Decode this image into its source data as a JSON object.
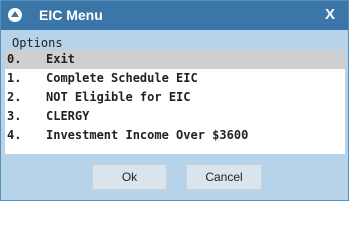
{
  "window": {
    "title": "EIC Menu",
    "close_label": "X",
    "icon": "app-icon"
  },
  "options": {
    "label": "Options",
    "selected_index": 0,
    "items": [
      {
        "num": "0.",
        "label": "Exit"
      },
      {
        "num": "1.",
        "label": "Complete Schedule EIC"
      },
      {
        "num": "2.",
        "label": "NOT Eligible for EIC"
      },
      {
        "num": "3.",
        "label": "CLERGY"
      },
      {
        "num": "4.",
        "label": "Investment Income Over $3600"
      }
    ]
  },
  "buttons": {
    "ok_label": "Ok",
    "cancel_label": "Cancel"
  },
  "colors": {
    "titlebar": "#3a77a8",
    "window_bg": "#b7d3e9",
    "selected_row": "#cfcfcf",
    "button_bg": "#d9e4ec"
  }
}
